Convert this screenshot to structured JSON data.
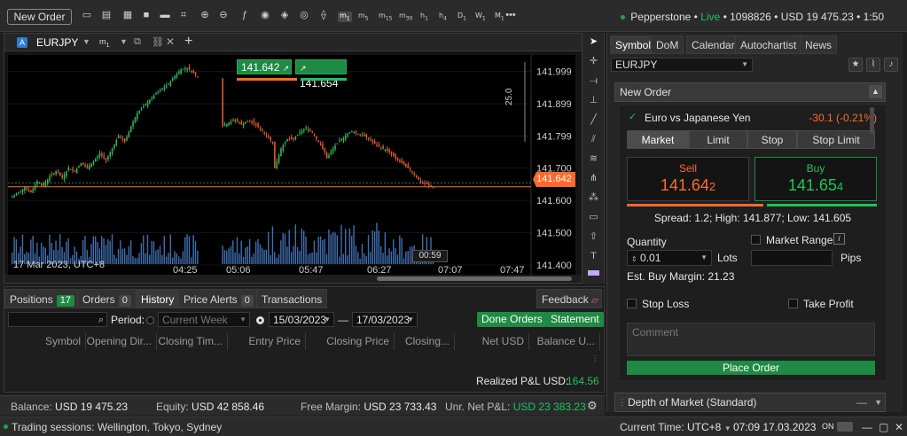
{
  "toolbar": {
    "new_order": "New Order",
    "timeframes": [
      {
        "label": "m",
        "sub": "1",
        "active": true
      },
      {
        "label": "m",
        "sub": "5"
      },
      {
        "label": "m",
        "sub": "15"
      },
      {
        "label": "m",
        "sub": "30"
      },
      {
        "label": "h",
        "sub": "1"
      },
      {
        "label": "h",
        "sub": "4"
      },
      {
        "label": "D",
        "sub": "1"
      },
      {
        "label": "W",
        "sub": "1"
      },
      {
        "label": "M",
        "sub": "1"
      }
    ],
    "more": "•••",
    "broker": "Pepperstone",
    "live": "Live",
    "account_id": "1098826",
    "balance": "USD 19 475.23",
    "leverage": "1:50"
  },
  "chart": {
    "tab_symbol": "EURJPY",
    "tab_timeframe": "m",
    "tab_timeframe_sub": "1",
    "sell_quick": "141.642",
    "buy_quick": "141.654",
    "current_price": "141.642",
    "countdown": "00:59",
    "date_label": "17 Mar 2023, UTC+8",
    "depth_label": "25.0"
  },
  "chart_data": {
    "type": "candlestick",
    "symbol": "EURJPY",
    "timeframe": "m1",
    "x_ticks": [
      "04:25",
      "05:06",
      "05:47",
      "06:27",
      "07:07",
      "07:47"
    ],
    "y_ticks": [
      141.999,
      141.899,
      141.799,
      141.7,
      141.6,
      141.5,
      141.4
    ],
    "ylim": [
      141.37,
      142.05
    ],
    "current_bid": 141.642,
    "current_ask": 141.654,
    "close_path": [
      [
        0,
        141.61
      ],
      [
        3,
        141.625
      ],
      [
        6,
        141.64
      ],
      [
        9,
        141.625
      ],
      [
        12,
        141.66
      ],
      [
        15,
        141.645
      ],
      [
        18,
        141.675
      ],
      [
        21,
        141.69
      ],
      [
        24,
        141.67
      ],
      [
        27,
        141.7
      ],
      [
        30,
        141.69
      ],
      [
        33,
        141.715
      ],
      [
        36,
        141.7
      ],
      [
        39,
        141.72
      ],
      [
        42,
        141.745
      ],
      [
        45,
        141.725
      ],
      [
        48,
        141.76
      ],
      [
        51,
        141.8
      ],
      [
        54,
        141.78
      ],
      [
        57,
        141.83
      ],
      [
        60,
        141.87
      ],
      [
        63,
        141.89
      ],
      [
        66,
        141.91
      ],
      [
        69,
        141.93
      ],
      [
        72,
        141.945
      ],
      [
        75,
        141.96
      ],
      [
        78,
        141.985
      ],
      [
        81,
        142.005
      ],
      [
        84,
        142.01
      ],
      [
        87,
        141.995
      ],
      [
        90,
        141.975
      ],
      [
        101,
        141.83
      ],
      [
        104,
        141.84
      ],
      [
        107,
        141.85
      ],
      [
        110,
        141.835
      ],
      [
        113,
        141.845
      ],
      [
        116,
        141.84
      ],
      [
        119,
        141.82
      ],
      [
        122,
        141.8
      ],
      [
        125,
        141.78
      ],
      [
        126,
        141.7
      ],
      [
        129,
        141.76
      ],
      [
        132,
        141.79
      ],
      [
        135,
        141.79
      ],
      [
        138,
        141.81
      ],
      [
        141,
        141.825
      ],
      [
        144,
        141.81
      ],
      [
        147,
        141.78
      ],
      [
        150,
        141.75
      ],
      [
        151,
        141.73
      ],
      [
        154,
        141.76
      ],
      [
        157,
        141.785
      ],
      [
        160,
        141.8
      ],
      [
        163,
        141.815
      ],
      [
        166,
        141.805
      ],
      [
        169,
        141.8
      ],
      [
        172,
        141.785
      ],
      [
        175,
        141.77
      ],
      [
        178,
        141.76
      ],
      [
        181,
        141.75
      ],
      [
        184,
        141.73
      ],
      [
        187,
        141.715
      ],
      [
        190,
        141.7
      ],
      [
        193,
        141.68
      ],
      [
        196,
        141.655
      ],
      [
        199,
        141.65
      ],
      [
        202,
        141.64
      ]
    ]
  },
  "right_panel": {
    "tabs": [
      "Symbol",
      "DoM",
      "Calendar",
      "Autochartist",
      "News"
    ],
    "symbol": "EURJPY",
    "new_order_title": "New Order",
    "symbol_desc": "Euro vs Japanese Yen",
    "change": "-30.1 (-0.21%)",
    "order_types": [
      "Market",
      "Limit",
      "Stop",
      "Stop Limit"
    ],
    "sell_label": "Sell",
    "sell_price_main": "141.64",
    "sell_price_pip": "2",
    "buy_label": "Buy",
    "buy_price_main": "141.65",
    "buy_price_pip": "4",
    "spread": "Spread: 1.2; High: 141.877; Low: 141.605",
    "quantity_label": "Quantity",
    "quantity": "0.01",
    "lots": "Lots",
    "market_range": "Market Range",
    "pips": "Pips",
    "est_margin": "Est. Buy Margin: 21.23",
    "stop_loss": "Stop Loss",
    "take_profit": "Take Profit",
    "comment_placeholder": "Comment",
    "place_order": "Place Order",
    "depth_title": "Depth of Market (Standard)"
  },
  "bottom_panel": {
    "tabs": [
      {
        "label": "Positions",
        "count": "17",
        "green": true
      },
      {
        "label": "Orders",
        "count": "0"
      },
      {
        "label": "History",
        "active": true
      },
      {
        "label": "Price Alerts",
        "count": "0"
      },
      {
        "label": "Transactions"
      }
    ],
    "feedback": "Feedback",
    "period_label": "Period:",
    "current_week": "Current Week",
    "date_from": "15/03/2023",
    "dash": "—",
    "date_to": "17/03/2023",
    "done_orders": "Done Orders",
    "statement": "Statement",
    "columns": [
      "Symbol",
      "Opening Dir...",
      "Closing Tim...",
      "Entry Price",
      "Closing Price",
      "Closing...",
      "Net USD",
      "Balance U..."
    ],
    "realized_label": "Realized P&L USD:",
    "realized_value": "164.56"
  },
  "status": {
    "balance_label": "Balance:",
    "balance": "USD 19 475.23",
    "equity_label": "Equity:",
    "equity": "USD 42 858.46",
    "free_margin_label": "Free Margin:",
    "free_margin": "USD 23 733.43",
    "unr_label": "Unr. Net P&L:",
    "unr_value": "USD 23 383.23"
  },
  "footer": {
    "sessions": "Trading sessions: Wellington, Tokyo, Sydney",
    "current_time_label": "Current Time:",
    "tz": "UTC+8",
    "time": "07:09 17.03.2023",
    "on": "ON"
  },
  "colors": {
    "buy": "#1fc35a",
    "sell": "#ff6a2b",
    "accent_green": "#1e8a43",
    "neg": "#ff6a2b"
  }
}
